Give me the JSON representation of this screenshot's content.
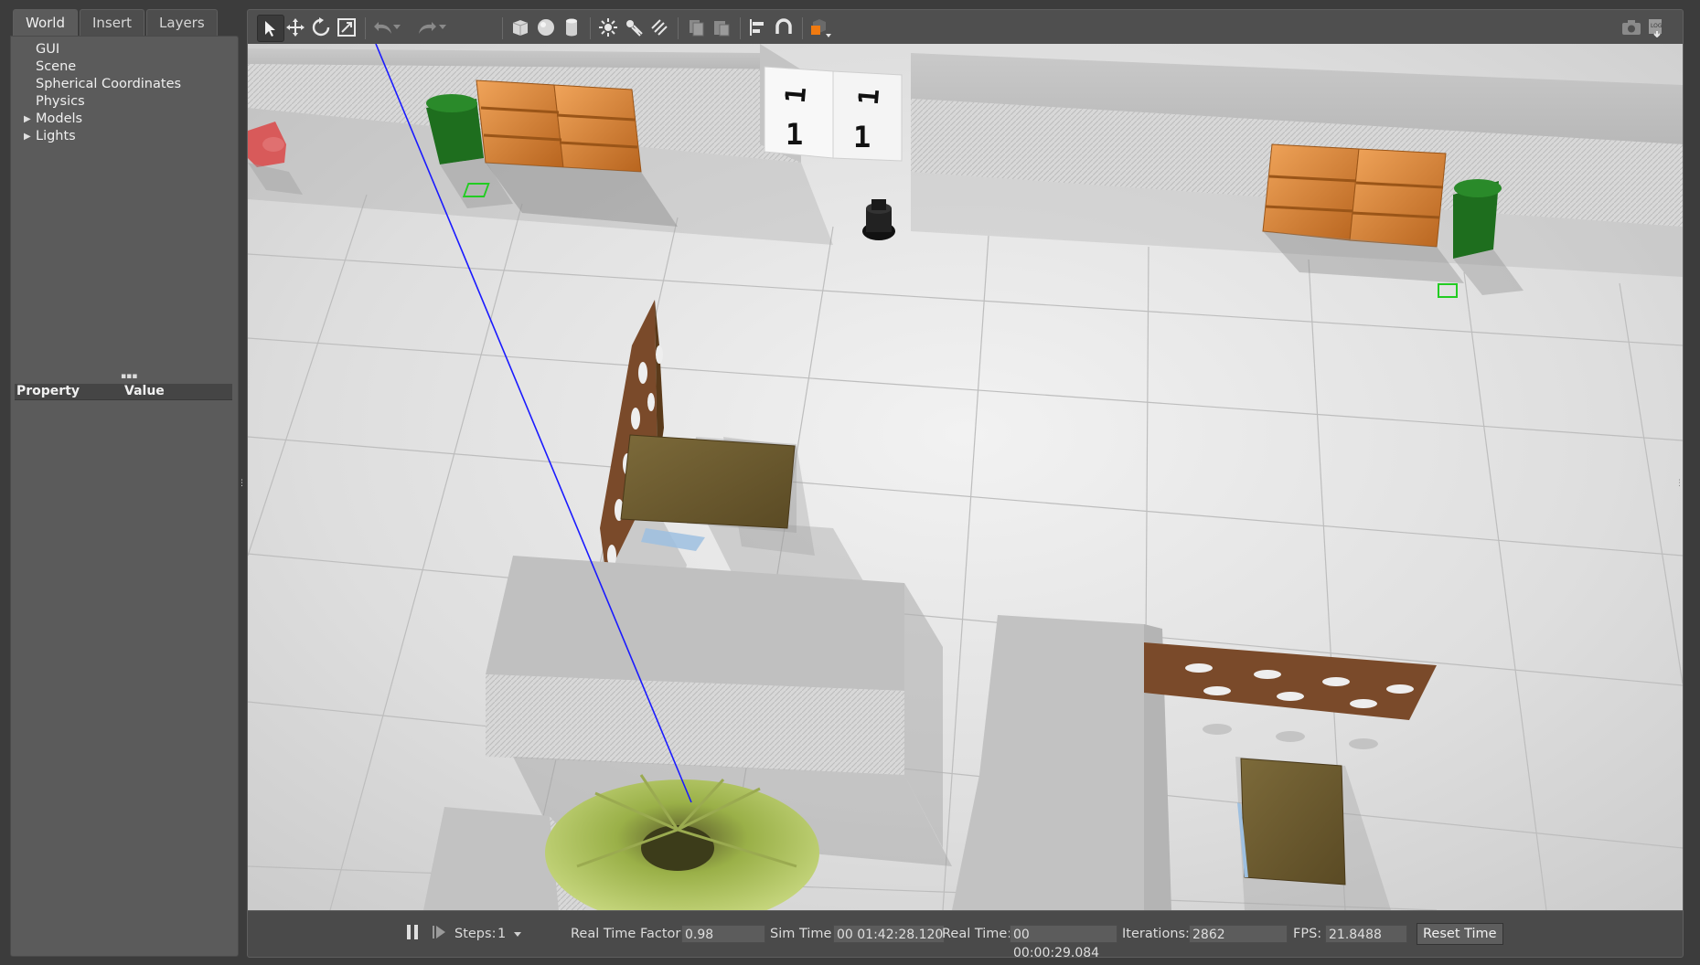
{
  "left_panel": {
    "tabs": [
      {
        "label": "World"
      },
      {
        "label": "Insert"
      },
      {
        "label": "Layers"
      }
    ],
    "tree": [
      {
        "label": "GUI"
      },
      {
        "label": "Scene"
      },
      {
        "label": "Spherical Coordinates"
      },
      {
        "label": "Physics"
      },
      {
        "label": "Models"
      },
      {
        "label": "Lights"
      }
    ],
    "property_header": {
      "property": "Property",
      "value": "Value"
    }
  },
  "toolbar": {
    "tools": [
      "select-icon",
      "translate-icon",
      "rotate-icon",
      "scale-icon",
      "undo-icon",
      "redo-icon",
      "box-icon",
      "sphere-icon",
      "cylinder-icon",
      "point-light-icon",
      "spot-light-icon",
      "directional-light-icon",
      "copy-icon",
      "paste-icon",
      "align-icon",
      "snap-icon",
      "view-angle-icon",
      "screenshot-icon",
      "log-icon"
    ]
  },
  "viewport": {
    "sign_digits": [
      "1",
      "1",
      "1",
      "1"
    ]
  },
  "bottom_bar": {
    "steps_label": "Steps:",
    "steps_value": "1",
    "rtf_label": "Real Time Factor:",
    "rtf_value": "0.98",
    "sim_time_label": "Sim Time:",
    "sim_time_value": "00 01:42:28.120",
    "real_time_label": "Real Time:",
    "real_time_value": "00 00:00:29.084",
    "iterations_label": "Iterations:",
    "iterations_value": "2862",
    "fps_label": "FPS:",
    "fps_value": "21.8488",
    "reset_label": "Reset Time"
  },
  "colors": {
    "accent_orange": "#f07a10",
    "axis_blue": "#1a1aff"
  }
}
